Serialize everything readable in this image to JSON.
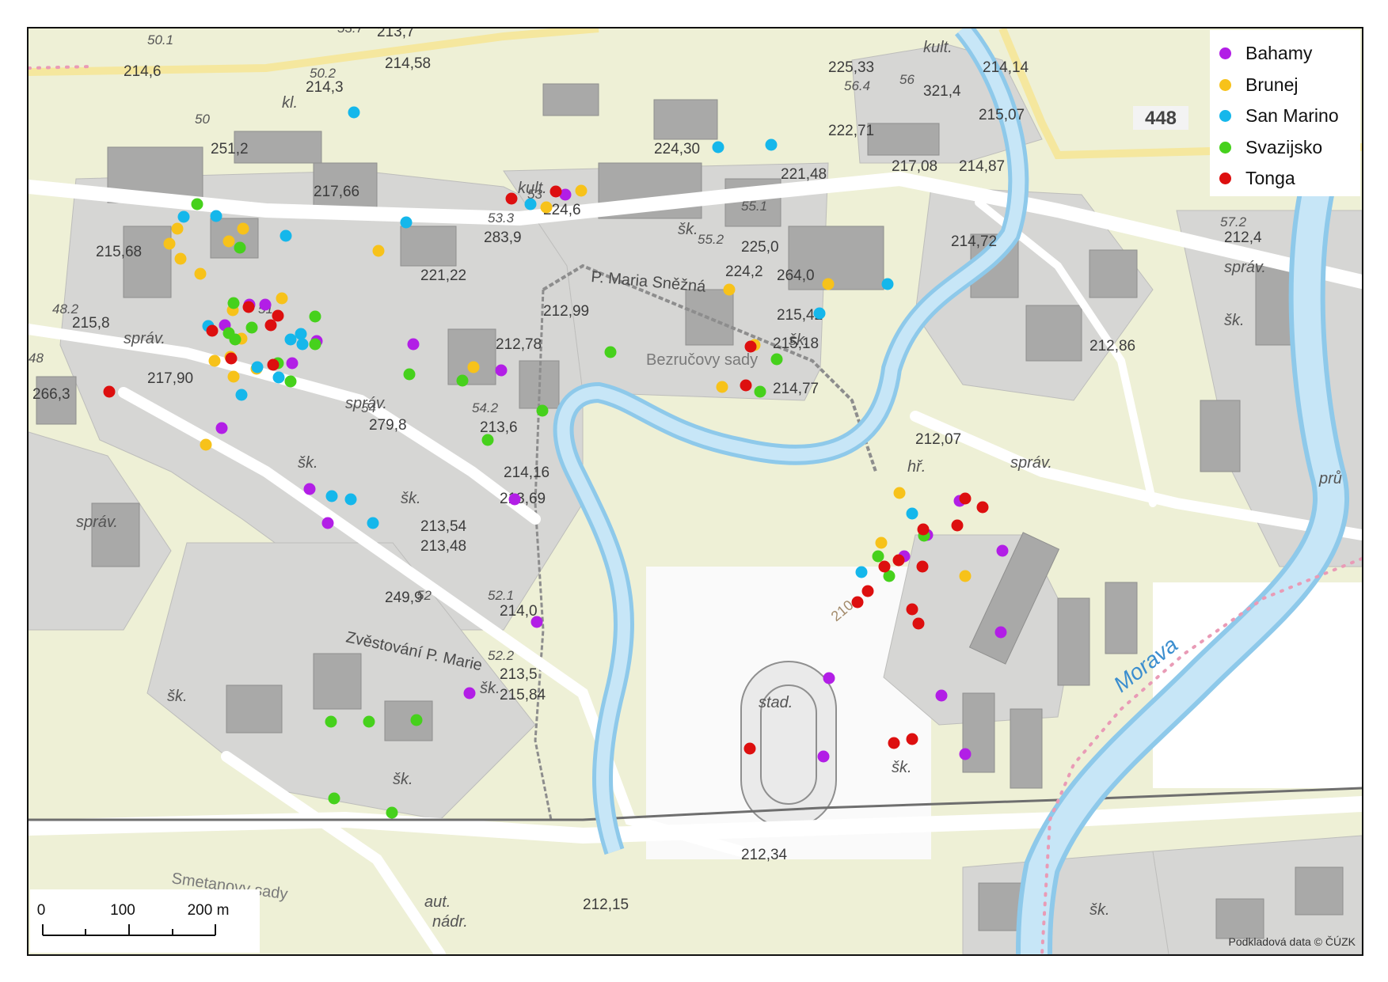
{
  "map": {
    "legend": [
      {
        "name": "Bahamy",
        "color": "#b21ee6"
      },
      {
        "name": "Brunej",
        "color": "#f7c21a"
      },
      {
        "name": "San Marino",
        "color": "#15b7eb"
      },
      {
        "name": "Svazijsko",
        "color": "#46d11c"
      },
      {
        "name": "Tonga",
        "color": "#dd0f0f"
      }
    ],
    "scalebar": {
      "labels": [
        "0",
        "100",
        "200 m"
      ]
    },
    "credit": "Podkladová data © ČÚZK",
    "river_label": "Morava",
    "road_number": "448",
    "place_labels": {
      "maria_snezna": "P. Maria Sněžná",
      "bezrucovy_sady": "Bezručovy sady",
      "zvestovani": "Zvěstování P. Marie",
      "smetanovy_sady": "Smetanovy sady",
      "stad": "stad.",
      "aut_nadr_1": "aut.",
      "aut_nadr_2": "nádr.",
      "hr": "hř.",
      "kult_1": "kult.",
      "kult_2": "kult.",
      "kl": "kl.",
      "sprav": "správ.",
      "sk": "šk.",
      "pru": "prů"
    },
    "elevations": [
      "214,6",
      "214,58",
      "214,3",
      "251,2",
      "217,66",
      "215,68",
      "215,8",
      "217,90",
      "266,3",
      "221,22",
      "283,9",
      "224,6",
      "224,30",
      "221,48",
      "225,33",
      "222,71",
      "321,4",
      "214,14",
      "215,07",
      "217,08",
      "214,87",
      "214,72",
      "212,4",
      "225,0",
      "224,2",
      "264,0",
      "215,42",
      "215,18",
      "214,77",
      "212,99",
      "212,78",
      "279,8",
      "213,6",
      "214,16",
      "213,69",
      "213,54",
      "213,48",
      "249,9",
      "214,0",
      "213,5",
      "215,84",
      "212,07",
      "212,86",
      "212,34",
      "212,15",
      "213,7",
      "50.1",
      "50.2",
      "53.7",
      "56.4",
      "56",
      "55.1",
      "55.2",
      "57.2",
      "48.2",
      "48",
      "54",
      "54.2",
      "52",
      "52.1",
      "52.2",
      "53",
      "53.3",
      "50",
      "51",
      "210"
    ]
  }
}
